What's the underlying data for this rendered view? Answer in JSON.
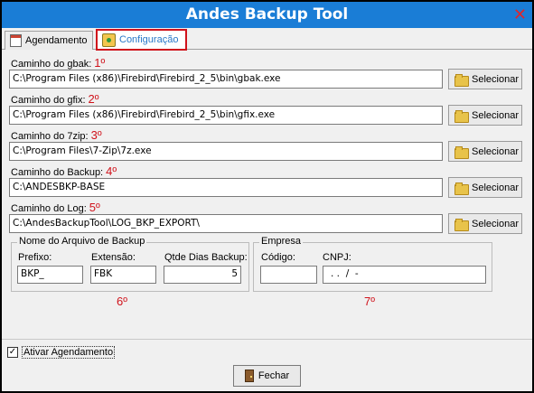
{
  "window": {
    "title": "Andes Backup Tool",
    "close_glyph": "✕"
  },
  "tabs": [
    {
      "label": "Agendamento",
      "icon": "calendar-icon"
    },
    {
      "label": "Configuração",
      "icon": "config-icon"
    }
  ],
  "fields": [
    {
      "label": "Caminho do gbak:",
      "marker": "1º",
      "value": "C:\\Program Files (x86)\\Firebird\\Firebird_2_5\\bin\\gbak.exe"
    },
    {
      "label": "Caminho do gfix:",
      "marker": "2º",
      "value": "C:\\Program Files (x86)\\Firebird\\Firebird_2_5\\bin\\gfix.exe"
    },
    {
      "label": "Caminho do 7zip:",
      "marker": "3º",
      "value": "C:\\Program Files\\7-Zip\\7z.exe"
    },
    {
      "label": "Caminho do Backup:",
      "marker": "4º",
      "value": "C:\\ANDESBKP-BASE"
    },
    {
      "label": "Caminho do Log:",
      "marker": "5º",
      "value": "C:\\AndesBackupTool\\LOG_BKP_EXPORT\\"
    }
  ],
  "select_button": {
    "label": "Selecionar",
    "icon": "folder-icon"
  },
  "backup_name_group": {
    "title": "Nome do Arquivo de Backup",
    "prefix_label": "Prefixo:",
    "prefix_value": "BKP_",
    "ext_label": "Extensão:",
    "ext_value": "FBK",
    "days_label": "Qtde Dias Backup:",
    "days_value": "5",
    "marker": "6º"
  },
  "empresa_group": {
    "title": "Empresa",
    "code_label": "Código:",
    "code_value": "",
    "cnpj_label": "CNPJ:",
    "cnpj_value": ". .  /  -",
    "marker": "7º"
  },
  "schedule_checkbox": {
    "label": "Ativar Agendamento",
    "checked": true,
    "mark": "✓"
  },
  "close_button": {
    "label": "Fechar",
    "icon": "door-icon"
  },
  "colors": {
    "titlebar": "#1a7dd6",
    "highlight": "#d0121b",
    "tab_text": "#2a78c8"
  }
}
